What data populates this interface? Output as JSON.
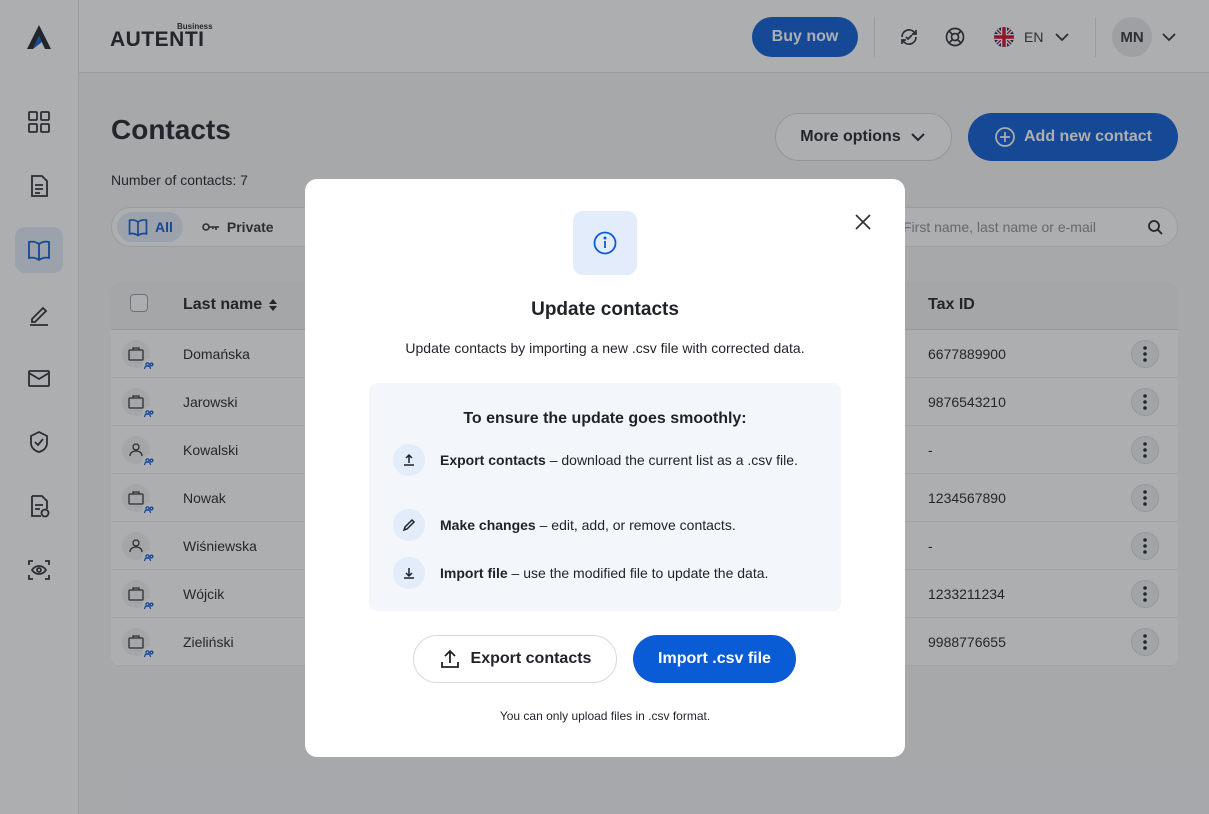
{
  "brand": {
    "sub": "Business",
    "word": "AUTENTI"
  },
  "topbar": {
    "buy_label": "Buy now",
    "lang": "EN",
    "avatar_initials": "MN"
  },
  "page": {
    "title": "Contacts",
    "count_text": "Number of contacts: 7"
  },
  "actions": {
    "more_label": "More options",
    "add_label": "Add new contact"
  },
  "filters": [
    {
      "label": "All"
    },
    {
      "label": "Private"
    }
  ],
  "search": {
    "placeholder": "First name, last name or e-mail"
  },
  "table": {
    "headers": {
      "last_name": "Last name",
      "tax_id": "Tax ID"
    },
    "rows": [
      {
        "last_name": "Domańska",
        "tax_id": "6677889900",
        "type": "company"
      },
      {
        "last_name": "Jarowski",
        "tax_id": "9876543210",
        "type": "company"
      },
      {
        "last_name": "Kowalski",
        "tax_id": "-",
        "type": "person"
      },
      {
        "last_name": "Nowak",
        "tax_id": "1234567890",
        "type": "company"
      },
      {
        "last_name": "Wiśniewska",
        "tax_id": "-",
        "type": "person"
      },
      {
        "last_name": "Wójcik",
        "tax_id": "1233211234",
        "type": "company"
      },
      {
        "last_name": "Zieliński",
        "tax_id": "9988776655",
        "type": "company"
      }
    ]
  },
  "modal": {
    "title": "Update contacts",
    "description": "Update contacts by importing a new .csv file with corrected data.",
    "steps_heading": "To ensure the update goes smoothly:",
    "steps": [
      {
        "bold": "Export contacts",
        "text": " – download the current list as a .csv file.",
        "icon": "upload-icon"
      },
      {
        "bold": "Make changes",
        "text": " – edit, add, or remove contacts.",
        "icon": "pencil-icon"
      },
      {
        "bold": "Import file",
        "text": " – use the modified file to update the data.",
        "icon": "download-icon"
      }
    ],
    "export_label": "Export contacts",
    "import_label": "Import .csv file",
    "note": "You can only upload files in .csv format."
  },
  "colors": {
    "accent": "#0a5bd6",
    "accent_soft": "#e3ecfa"
  }
}
